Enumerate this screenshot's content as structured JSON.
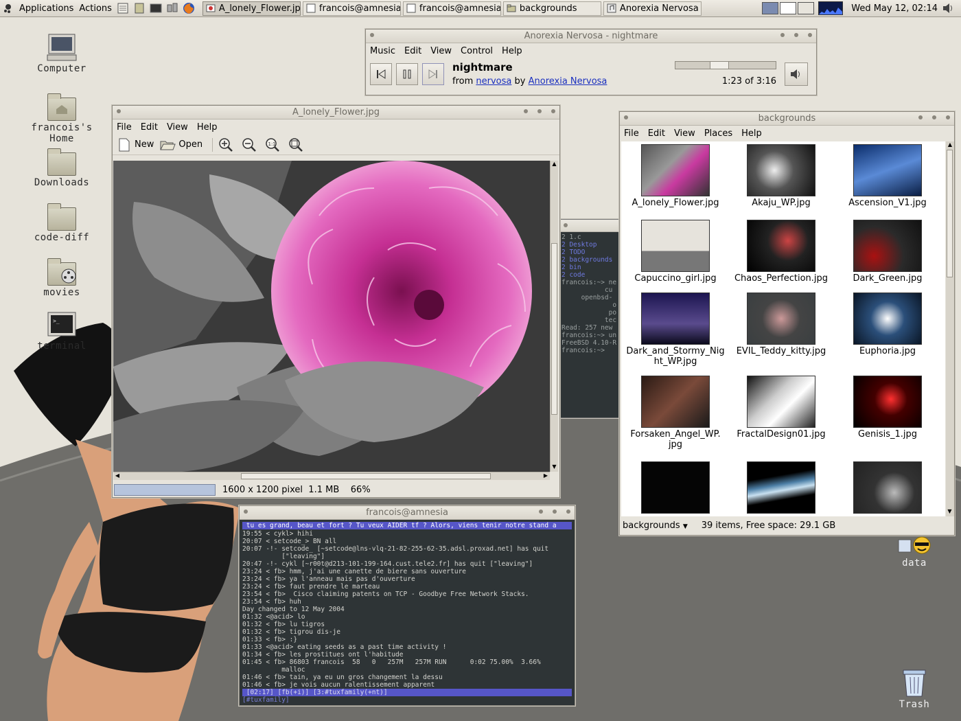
{
  "panel": {
    "applications": "Applications",
    "actions": "Actions",
    "tasks": [
      {
        "label": "A_lonely_Flower.jpg",
        "icon": "image-viewer-icon"
      },
      {
        "label": "francois@amnesia",
        "icon": "terminal-window-icon"
      },
      {
        "label": "francois@amnesia",
        "icon": "terminal-window-icon"
      },
      {
        "label": "backgrounds",
        "icon": "folder-icon"
      },
      {
        "label": "Anorexia Nervosa - r",
        "icon": "music-player-icon"
      }
    ],
    "clock": "Wed May 12, 02:14"
  },
  "desktop": {
    "icons": [
      {
        "label": "Computer"
      },
      {
        "label": "francois's Home"
      },
      {
        "label": "Downloads"
      },
      {
        "label": "code-diff"
      },
      {
        "label": "movies"
      },
      {
        "label": "terminal"
      },
      {
        "label": "data"
      },
      {
        "label": "Trash"
      }
    ]
  },
  "player": {
    "title": "Anorexia Nervosa - nightmare",
    "menu": [
      "Music",
      "Edit",
      "View",
      "Control",
      "Help"
    ],
    "track": "nightmare",
    "from_label": "from",
    "album": "nervosa",
    "by_label": "by",
    "artist": "Anorexia Nervosa",
    "time": "1:23 of 3:16",
    "progress": 0.42
  },
  "viewer": {
    "title": "A_lonely_Flower.jpg",
    "menu": [
      "File",
      "Edit",
      "View",
      "Help"
    ],
    "new_label": "New",
    "open_label": "Open",
    "dimensions": "1600 x 1200 pixel",
    "size": "1.1 MB",
    "zoom": "66%"
  },
  "backgrounds": {
    "title": "backgrounds",
    "menu": [
      "File",
      "Edit",
      "View",
      "Places",
      "Help"
    ],
    "location": "backgrounds",
    "status": "39 items, Free space: 29.1 GB",
    "files": [
      {
        "name": "A_lonely_Flower.jpg"
      },
      {
        "name": "Akaju_WP.jpg"
      },
      {
        "name": "Ascension_V1.jpg"
      },
      {
        "name": "Capuccino_girl.jpg"
      },
      {
        "name": "Chaos_Perfection.jpg"
      },
      {
        "name": "Dark_Green.jpg"
      },
      {
        "name": "Dark_and_Stormy_Nig ht_WP.jpg"
      },
      {
        "name": "EVIL_Teddy_kitty.jpg"
      },
      {
        "name": "Euphoria.jpg"
      },
      {
        "name": "Forsaken_Angel_WP. jpg"
      },
      {
        "name": "FractalDesign01.jpg"
      },
      {
        "name": "Genisis_1.jpg"
      },
      {
        "name": ""
      },
      {
        "name": ""
      },
      {
        "name": ""
      }
    ]
  },
  "term_bg": {
    "lines": [
      "2 1.c",
      "2 Desktop",
      "2 TODO",
      "2 backgrounds",
      "2 bin",
      "2 code",
      "francois:~> ne",
      "",
      "           cu",
      "",
      "     openbsd-",
      "             o",
      "            po",
      "",
      "",
      "           tec",
      "",
      "",
      "Read: 257 new",
      "francois:~> un",
      "FreeBSD 4.10-R",
      "francois:~> "
    ]
  },
  "irc": {
    "title": "francois@amnesia",
    "topic": " tu es grand, beau et fort ? Tu veux AIDER tf ? Alors, viens tenir notre stand a",
    "lines": [
      "19:55 < cykl> hihi",
      "20:07 < setcode_> BN all",
      "20:07 -!- setcode_ [~setcode@lns-vlq-21-82-255-62-35.adsl.proxad.net] has quit",
      "          [\"leaving\"]",
      "20:47 -!- cykl [~r00t@d213-101-199-164.cust.tele2.fr] has quit [\"leaving\"]",
      "23:24 < fb> hmm, j'ai une canette de biere sans ouverture",
      "23:24 < fb> ya l'anneau mais pas d'ouverture",
      "23:24 < fb> faut prendre le marteau",
      "23:54 < fb>  Cisco claiming patents on TCP - Goodbye Free Network Stacks.",
      "23:54 < fb> huh",
      "Day changed to 12 May 2004",
      "01:32 <@acid> lo",
      "01:32 < fb> lu tigros",
      "01:32 < fb> tigrou dis-je",
      "01:33 < fb> :}",
      "01:33 <@acid> eating seeds as a past time activity !",
      "01:34 < fb> les prostitues ont l'habitude",
      "01:45 < fb> 86803 francois  58   0   257M   257M RUN      0:02 75.00%  3.66%",
      "          malloc",
      "01:46 < fb> tain, ya eu un gros changement la dessu",
      "01:46 < fb> je vois aucun ralentissement apparent"
    ],
    "statusline": " [02:17] [fb(+i)] [3:#tuxfamily(+nt)]",
    "input": "[#tuxfamily] "
  }
}
